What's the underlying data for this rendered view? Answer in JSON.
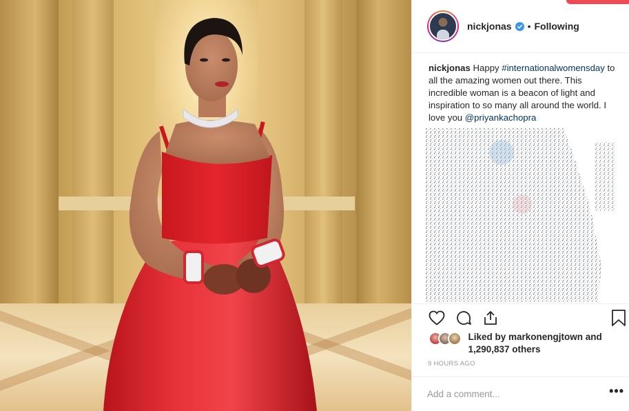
{
  "post": {
    "username": "nickjonas",
    "verified": true,
    "follow_separator": "•",
    "follow_state": "Following",
    "caption": {
      "username": "nickjonas",
      "text_before": " Happy ",
      "hashtag": "#internationalwomensday",
      "text_after": " to all the amazing women out there. This incredible woman is a beacon of light and inspiration to so many all around the world. I love you ",
      "mention": "@priyankachopra"
    },
    "likes": {
      "prefix": "Liked by ",
      "user": "markonengjtown",
      "connector": " and ",
      "count": "1,290,837 others"
    },
    "timestamp": "9 HOURS AGO",
    "comment_placeholder": "Add a comment...",
    "more_label": "•••"
  },
  "colors": {
    "dress_red": "#e0232b",
    "link_blue": "#003569",
    "verified_blue": "#3897f0",
    "notification_red": "#ed4956"
  },
  "icons": [
    "heart-icon",
    "comment-icon",
    "share-icon",
    "bookmark-icon",
    "verified-icon",
    "more-options-icon"
  ]
}
